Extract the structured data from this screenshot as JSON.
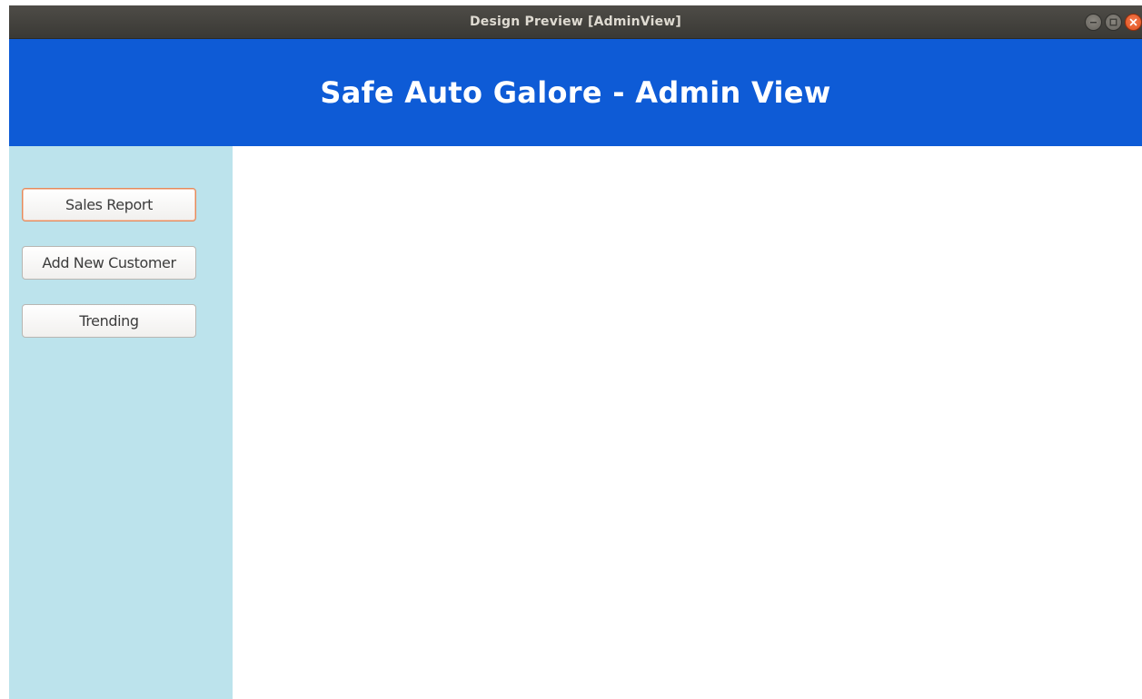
{
  "window": {
    "title": "Design Preview [AdminView]"
  },
  "header": {
    "title": "Safe Auto Galore - Admin View"
  },
  "sidebar": {
    "items": [
      {
        "label": "Sales Report"
      },
      {
        "label": "Add New Customer"
      },
      {
        "label": "Trending"
      }
    ]
  },
  "icons": {
    "minimize": "minimize-icon",
    "maximize": "maximize-icon",
    "close": "close-icon"
  },
  "colors": {
    "header_bg": "#0e5bd6",
    "sidebar_bg": "#bce3ec",
    "titlebar_bg": "#3e3d39",
    "focus_border": "#e58a5c",
    "close_button": "#e0501d"
  }
}
